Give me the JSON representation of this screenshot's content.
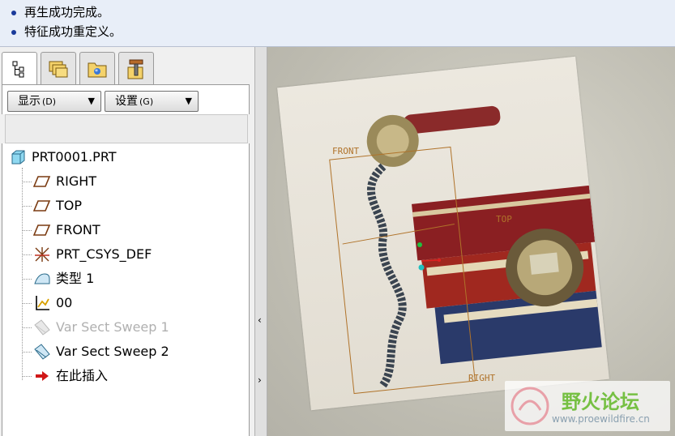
{
  "messages": [
    "再生成功完成。",
    "特征成功重定义。"
  ],
  "tabs": [
    {
      "name": "model-tree",
      "icon": "model-tree-icon"
    },
    {
      "name": "folder-browser",
      "icon": "folder-stack-icon"
    },
    {
      "name": "favorites",
      "icon": "folder-star-icon"
    },
    {
      "name": "connections",
      "icon": "tools-icon"
    }
  ],
  "toolbar": {
    "show_label": "显示",
    "show_key": "(D)",
    "settings_label": "设置",
    "settings_key": "(G)"
  },
  "tree": {
    "root": "PRT0001.PRT",
    "items": [
      {
        "label": "RIGHT",
        "icon": "datum-plane-icon",
        "state": "normal"
      },
      {
        "label": "TOP",
        "icon": "datum-plane-icon",
        "state": "normal"
      },
      {
        "label": "FRONT",
        "icon": "datum-plane-icon",
        "state": "normal"
      },
      {
        "label": "PRT_CSYS_DEF",
        "icon": "coordinate-system-icon",
        "state": "normal"
      },
      {
        "label": "类型 1",
        "icon": "surface-icon",
        "state": "normal"
      },
      {
        "label": "00",
        "icon": "sketch-icon",
        "state": "normal"
      },
      {
        "label": "Var Sect Sweep 1",
        "icon": "sweep-icon",
        "state": "suppressed"
      },
      {
        "label": "Var Sect Sweep 2",
        "icon": "sweep-icon",
        "state": "normal"
      },
      {
        "label": "在此插入",
        "icon": "insert-here-arrow-icon",
        "state": "normal"
      }
    ]
  },
  "viewport": {
    "plane_labels": [
      "FRONT",
      "TOP",
      "RIGHT"
    ],
    "watermark_title": "野火论坛",
    "watermark_url": "www.proewildfire.cn"
  },
  "colors": {
    "message_bg": "#e8eef8",
    "plane": "#b0732a",
    "watermark_green": "#76c043"
  }
}
